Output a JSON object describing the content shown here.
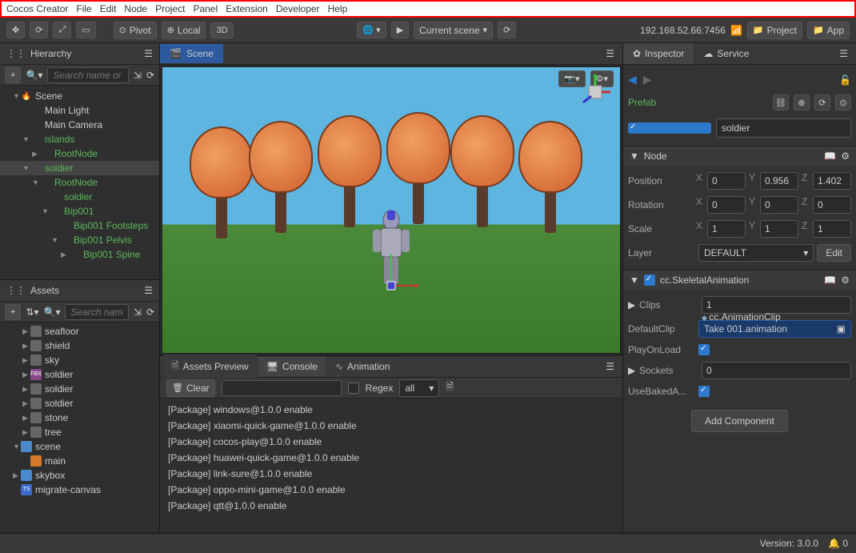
{
  "menu": [
    "Cocos Creator",
    "File",
    "Edit",
    "Node",
    "Project",
    "Panel",
    "Extension",
    "Developer",
    "Help"
  ],
  "toolbar": {
    "pivot": "Pivot",
    "local": "Local",
    "mode3d": "3D",
    "sceneSel": "Current scene",
    "ip": "192.168.52.66:7456",
    "proj": "Project",
    "app": "App"
  },
  "hierarchy": {
    "title": "Hierarchy",
    "searchPH": "Search name or",
    "items": [
      {
        "d": 1,
        "c": "▼",
        "icon": "🔥",
        "label": "Scene",
        "g": false
      },
      {
        "d": 2,
        "c": "",
        "icon": "",
        "label": "Main Light",
        "g": false
      },
      {
        "d": 2,
        "c": "",
        "icon": "",
        "label": "Main Camera",
        "g": false
      },
      {
        "d": 2,
        "c": "▼",
        "icon": "",
        "label": "islands",
        "g": true
      },
      {
        "d": 3,
        "c": "▶",
        "icon": "",
        "label": "RootNode",
        "g": true
      },
      {
        "d": 2,
        "c": "▼",
        "icon": "",
        "label": "soldier",
        "g": true,
        "sel": true
      },
      {
        "d": 3,
        "c": "▼",
        "icon": "",
        "label": "RootNode",
        "g": true
      },
      {
        "d": 4,
        "c": "",
        "icon": "",
        "label": "soldier",
        "g": true
      },
      {
        "d": 4,
        "c": "▼",
        "icon": "",
        "label": "Bip001",
        "g": true
      },
      {
        "d": 5,
        "c": "",
        "icon": "",
        "label": "Bip001 Footsteps",
        "g": true
      },
      {
        "d": 5,
        "c": "▼",
        "icon": "",
        "label": "Bip001 Pelvis",
        "g": true
      },
      {
        "d": 6,
        "c": "▶",
        "icon": "",
        "label": "Bip001 Spine",
        "g": true
      }
    ]
  },
  "assets": {
    "title": "Assets",
    "searchPH": "Search name",
    "items": [
      {
        "d": 2,
        "c": "▶",
        "type": "img",
        "label": "seafloor"
      },
      {
        "d": 2,
        "c": "▶",
        "type": "img",
        "label": "shield"
      },
      {
        "d": 2,
        "c": "▶",
        "type": "img",
        "label": "sky"
      },
      {
        "d": 2,
        "c": "▶",
        "type": "fbx",
        "label": "soldier"
      },
      {
        "d": 2,
        "c": "▶",
        "type": "img",
        "label": "soldier"
      },
      {
        "d": 2,
        "c": "▶",
        "type": "img",
        "label": "soldier"
      },
      {
        "d": 2,
        "c": "▶",
        "type": "img",
        "label": "stone"
      },
      {
        "d": 2,
        "c": "▶",
        "type": "img",
        "label": "tree"
      },
      {
        "d": 1,
        "c": "▼",
        "type": "folder",
        "label": "scene"
      },
      {
        "d": 2,
        "c": "",
        "type": "fire",
        "label": "main"
      },
      {
        "d": 1,
        "c": "▶",
        "type": "folder",
        "label": "skybox"
      },
      {
        "d": 1,
        "c": "",
        "type": "ts",
        "label": "migrate-canvas"
      }
    ]
  },
  "sceneTab": "Scene",
  "bottom": {
    "tabs": [
      "Assets Preview",
      "Console",
      "Animation"
    ],
    "clear": "Clear",
    "regex": "Regex",
    "all": "all",
    "logs": [
      "[Package] windows@1.0.0 enable",
      "[Package] xiaomi-quick-game@1.0.0 enable",
      "[Package] cocos-play@1.0.0 enable",
      "[Package] huawei-quick-game@1.0.0 enable",
      "[Package] link-sure@1.0.0 enable",
      "[Package] oppo-mini-game@1.0.0 enable",
      "[Package] qtt@1.0.0 enable"
    ]
  },
  "inspector": {
    "tabs": {
      "insp": "Inspector",
      "svc": "Service"
    },
    "prefab": "Prefab",
    "name": "soldier",
    "nodeHdr": "Node",
    "posLbl": "Position",
    "pos": {
      "x": "0",
      "y": "0.956",
      "z": "1.402"
    },
    "rotLbl": "Rotation",
    "rot": {
      "x": "0",
      "y": "0",
      "z": "0"
    },
    "scaleLbl": "Scale",
    "scale": {
      "x": "1",
      "y": "1",
      "z": "1"
    },
    "layerLbl": "Layer",
    "layer": "DEFAULT",
    "edit": "Edit",
    "compHdr": "cc.SkeletalAnimation",
    "clipsLbl": "Clips",
    "clips": "1",
    "defClipLbl": "DefaultClip",
    "clipType": "cc.AnimationClip",
    "defClip": "Take 001.animation",
    "playLbl": "PlayOnLoad",
    "socketsLbl": "Sockets",
    "sockets": "0",
    "bakedLbl": "UseBakedA...",
    "addComp": "Add Component"
  },
  "status": {
    "version": "Version: 3.0.0",
    "notif": "0"
  }
}
